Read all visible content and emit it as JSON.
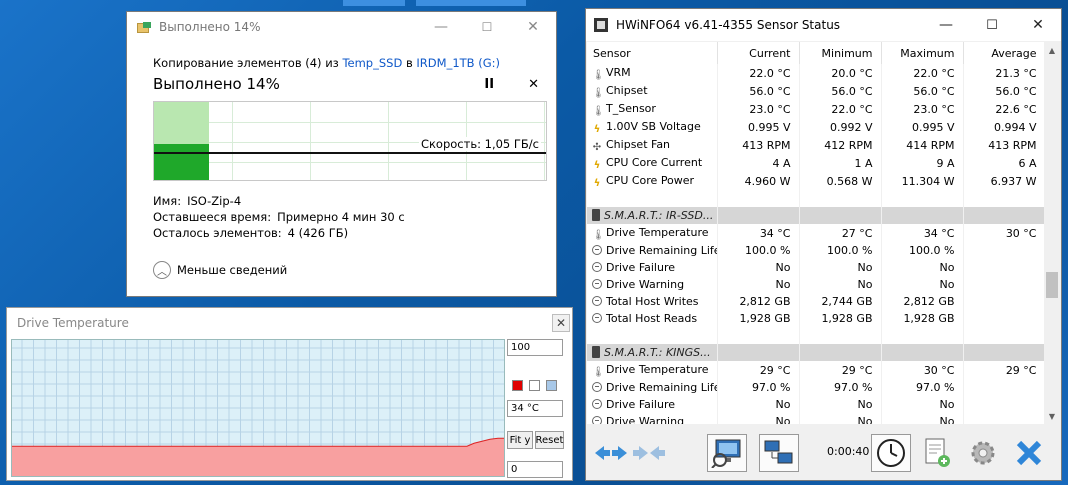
{
  "copy_dialog": {
    "title": "Выполнено 14%",
    "line_prefix": "Копирование элементов (4) из ",
    "source": "Temp_SSD",
    "line_mid": " в ",
    "dest": "IRDM_1TB (G:)",
    "status": "Выполнено 14%",
    "pause_label": "II",
    "cancel_label": "✕",
    "progress_percent": 14,
    "speed_text": "Скорость: 1,05 ГБ/с",
    "name_label": "Имя:",
    "name_value": "ISO-Zip-4",
    "time_label": "Оставшееся время:",
    "time_value": "Примерно 4 мин 30 с",
    "items_label": "Осталось элементов:",
    "items_value": "4 (426 ГБ)",
    "less_details": "Меньше сведений"
  },
  "temp_window": {
    "title": "Drive Temperature",
    "max_value": "100",
    "current_value": "34 °C",
    "min_value": "0",
    "fit_label": "Fit y",
    "reset_label": "Reset",
    "swatch_colors": [
      "#e00000",
      "#ffffff",
      "#a8c8e8"
    ],
    "plot_bg": "#dcf0f8",
    "series_color": "#f8a0a0"
  },
  "hwinfo": {
    "title": "HWiNFO64 v6.41-4355 Sensor Status",
    "columns": [
      "Sensor",
      "Current",
      "Minimum",
      "Maximum",
      "Average"
    ],
    "rows": [
      {
        "icon": "therm",
        "name": "VRM",
        "cur": "22.0 °C",
        "min": "20.0 °C",
        "max": "22.0 °C",
        "avg": "21.3 °C"
      },
      {
        "icon": "therm",
        "name": "Chipset",
        "cur": "56.0 °C",
        "min": "56.0 °C",
        "max": "56.0 °C",
        "avg": "56.0 °C"
      },
      {
        "icon": "therm",
        "name": "T_Sensor",
        "cur": "23.0 °C",
        "min": "22.0 °C",
        "max": "23.0 °C",
        "avg": "22.6 °C"
      },
      {
        "icon": "bolt",
        "name": "1.00V SB Voltage",
        "cur": "0.995 V",
        "min": "0.992 V",
        "max": "0.995 V",
        "avg": "0.994 V"
      },
      {
        "icon": "fan",
        "name": "Chipset Fan",
        "cur": "413 RPM",
        "min": "412 RPM",
        "max": "414 RPM",
        "avg": "413 RPM"
      },
      {
        "icon": "bolt",
        "name": "CPU Core Current",
        "cur": "4 A",
        "min": "1 A",
        "max": "9 A",
        "avg": "6 A"
      },
      {
        "icon": "bolt",
        "name": "CPU Core Power",
        "cur": "4.960 W",
        "min": "0.568 W",
        "max": "11.304 W",
        "avg": "6.937 W"
      },
      {
        "type": "spacer"
      },
      {
        "type": "group",
        "name": "S.M.A.R.T.: IR-SSD..."
      },
      {
        "icon": "therm",
        "name": "Drive Temperature",
        "cur": "34 °C",
        "min": "27 °C",
        "max": "34 °C",
        "avg": "30 °C"
      },
      {
        "icon": "circ",
        "name": "Drive Remaining Life",
        "cur": "100.0 %",
        "min": "100.0 %",
        "max": "100.0 %",
        "avg": ""
      },
      {
        "icon": "circ",
        "name": "Drive Failure",
        "cur": "No",
        "min": "No",
        "max": "No",
        "avg": ""
      },
      {
        "icon": "circ",
        "name": "Drive Warning",
        "cur": "No",
        "min": "No",
        "max": "No",
        "avg": ""
      },
      {
        "icon": "circ",
        "name": "Total Host Writes",
        "cur": "2,812 GB",
        "min": "2,744 GB",
        "max": "2,812 GB",
        "avg": ""
      },
      {
        "icon": "circ",
        "name": "Total Host Reads",
        "cur": "1,928 GB",
        "min": "1,928 GB",
        "max": "1,928 GB",
        "avg": ""
      },
      {
        "type": "spacer"
      },
      {
        "type": "group",
        "name": "S.M.A.R.T.: KINGS..."
      },
      {
        "icon": "therm",
        "name": "Drive Temperature",
        "cur": "29 °C",
        "min": "29 °C",
        "max": "30 °C",
        "avg": "29 °C"
      },
      {
        "icon": "circ",
        "name": "Drive Remaining Life",
        "cur": "97.0 %",
        "min": "97.0 %",
        "max": "97.0 %",
        "avg": ""
      },
      {
        "icon": "circ",
        "name": "Drive Failure",
        "cur": "No",
        "min": "No",
        "max": "No",
        "avg": ""
      },
      {
        "icon": "circ",
        "name": "Drive Warning",
        "cur": "No",
        "min": "No",
        "max": "No",
        "avg": ""
      }
    ],
    "timer": "0:00:40"
  }
}
